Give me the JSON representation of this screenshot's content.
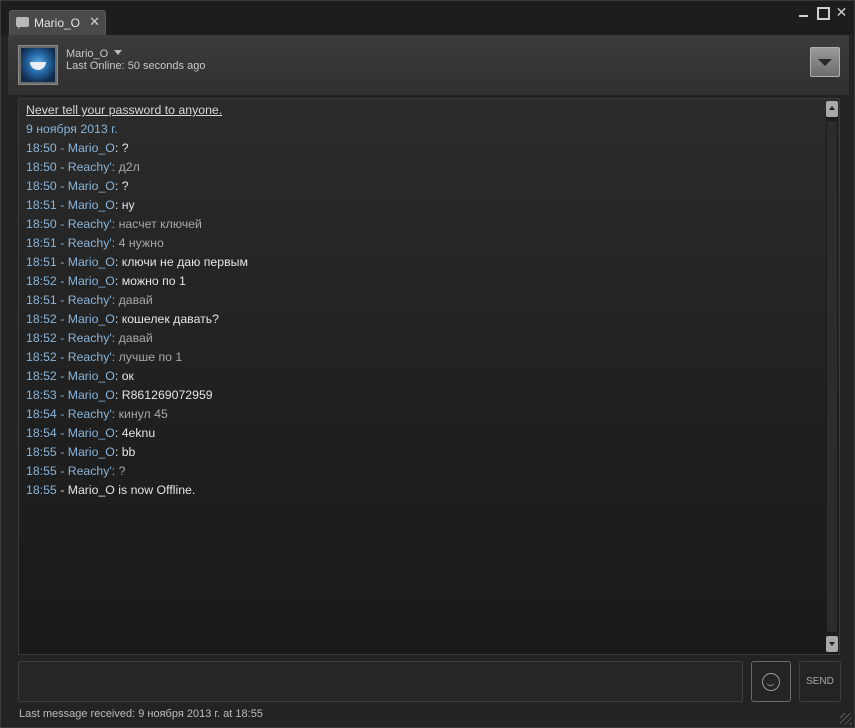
{
  "tab": {
    "label": "Mario_O",
    "close": "✕",
    "icon": "chat-bubble-icon"
  },
  "window_controls": {
    "minimize": "minimize-icon",
    "maximize": "maximize-icon",
    "close": "✕"
  },
  "header": {
    "friend_name": "Mario_O",
    "last_online_label": "Last Online:",
    "last_online_value": " 50 seconds ago"
  },
  "chat": {
    "notice": "Never tell your password to anyone.",
    "date": "9 ноября 2013 г.",
    "messages": [
      {
        "meta": "18:50 - Mario_O",
        "sep": ": ",
        "text": "?",
        "self": true
      },
      {
        "meta": "18:50 - Reachy'",
        "sep": ": ",
        "text": "д2л",
        "self": false
      },
      {
        "meta": "18:50 - Mario_O",
        "sep": ": ",
        "text": "?",
        "self": true
      },
      {
        "meta": "18:51 - Mario_O",
        "sep": ": ",
        "text": "ну",
        "self": true
      },
      {
        "meta": "18:50 - Reachy'",
        "sep": ": ",
        "text": "насчет ключей",
        "self": false
      },
      {
        "meta": "18:51 - Reachy'",
        "sep": ": ",
        "text": "4 нужно",
        "self": false
      },
      {
        "meta": "18:51 - Mario_O",
        "sep": ": ",
        "text": "ключи не даю первым",
        "self": true
      },
      {
        "meta": "18:52 - Mario_O",
        "sep": ": ",
        "text": "можно по 1",
        "self": true
      },
      {
        "meta": "18:51 - Reachy'",
        "sep": ": ",
        "text": "давай",
        "self": false
      },
      {
        "meta": "18:52 - Mario_O",
        "sep": ": ",
        "text": "кошелек давать?",
        "self": true
      },
      {
        "meta": "18:52 - Reachy'",
        "sep": ": ",
        "text": "давай",
        "self": false
      },
      {
        "meta": "18:52 - Reachy'",
        "sep": ": ",
        "text": "лучше по 1",
        "self": false
      },
      {
        "meta": "18:52 - Mario_O",
        "sep": ": ",
        "text": "ок",
        "self": true
      },
      {
        "meta": "18:53 - Mario_O",
        "sep": ": ",
        "text": "R861269072959",
        "self": true
      },
      {
        "meta": "18:54 - Reachy'",
        "sep": ": ",
        "text": "кинул 45",
        "self": false
      },
      {
        "meta": "18:54 - Mario_O",
        "sep": ": ",
        "text": "4eknu",
        "self": true
      },
      {
        "meta": "18:55 - Mario_O",
        "sep": ": ",
        "text": "bb",
        "self": true
      },
      {
        "meta": "18:55 - Reachy'",
        "sep": ": ",
        "text": "?",
        "self": false
      }
    ],
    "status_time": "18:55",
    "status_dash": " - ",
    "status_text": "Mario_O is now Offline."
  },
  "input": {
    "placeholder": "",
    "value": ""
  },
  "send_label": "SEND",
  "statusbar": {
    "text": "Last message received: 9 ноября 2013 г. at 18:55"
  },
  "colors": {
    "timestamp": "#8ab4d8",
    "self_text": "#e4e4e4",
    "other_text": "#a8a8a8",
    "background": "#232323"
  }
}
